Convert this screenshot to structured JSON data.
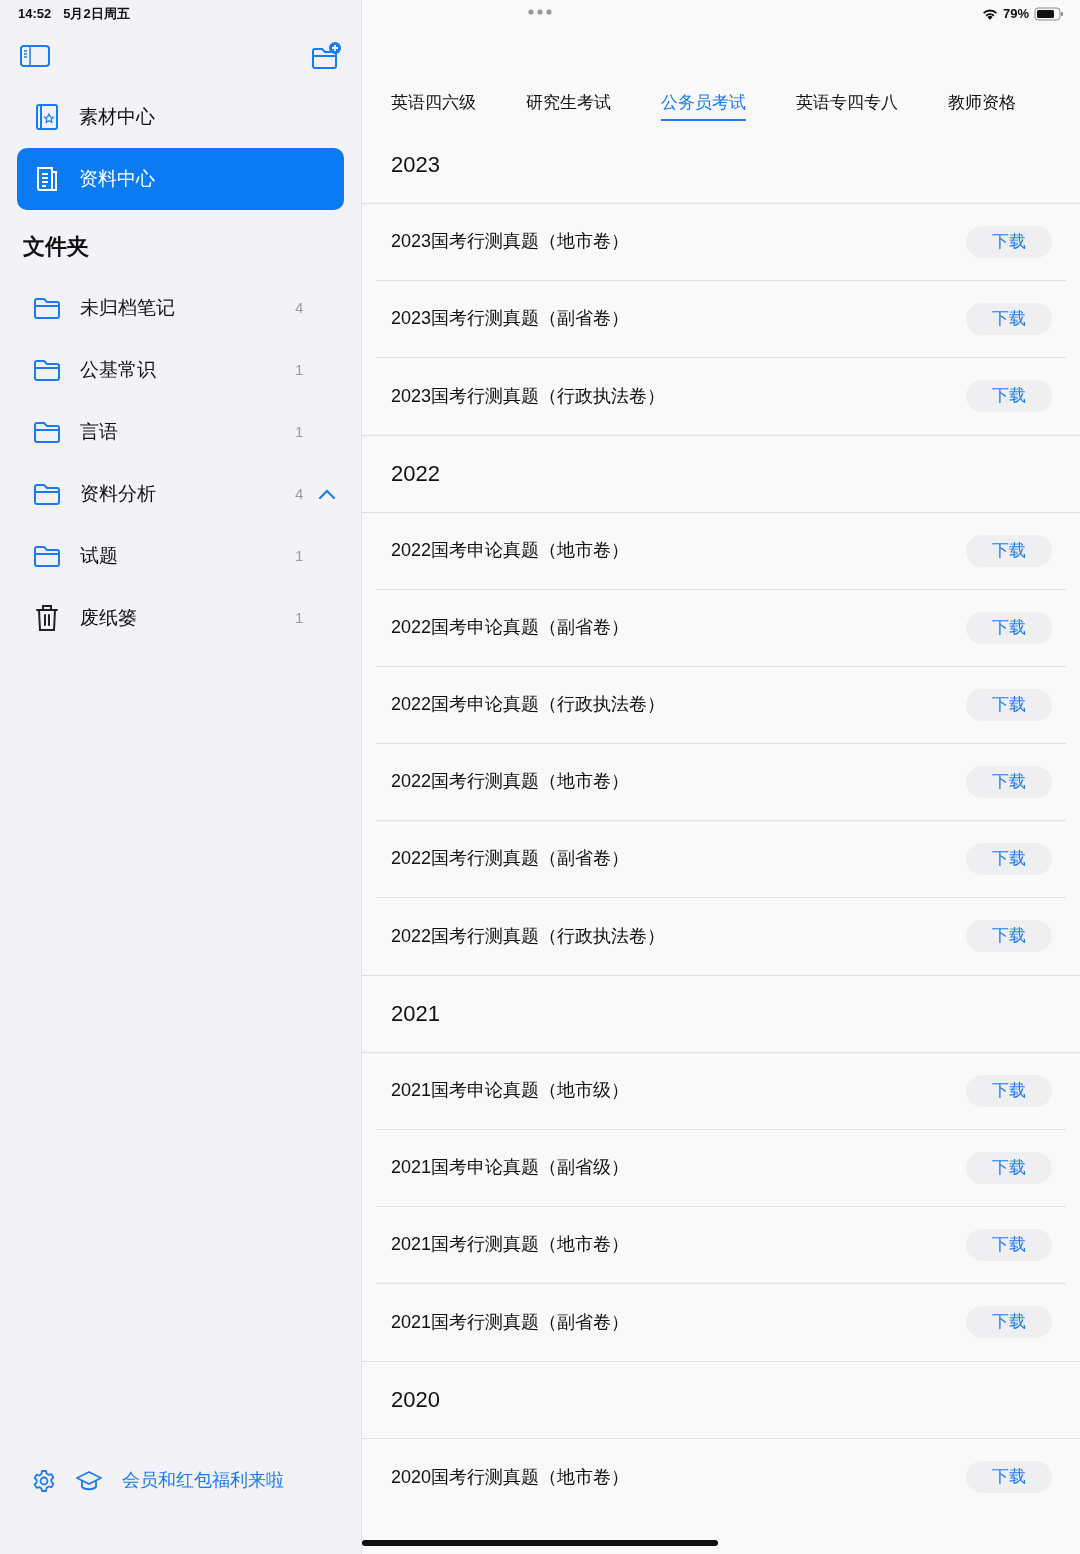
{
  "status_bar": {
    "time": "14:52",
    "date": "5月2日周五",
    "battery": "79%"
  },
  "sidebar": {
    "nav": [
      {
        "label": "素材中心",
        "kind": "book",
        "selected": false
      },
      {
        "label": "资料中心",
        "kind": "doc",
        "selected": true
      }
    ],
    "folders_title": "文件夹",
    "folders": [
      {
        "kind": "folder",
        "label": "未归档笔记",
        "count": "4"
      },
      {
        "kind": "folder",
        "label": "公基常识",
        "count": "1"
      },
      {
        "kind": "folder",
        "label": "言语",
        "count": "1"
      },
      {
        "kind": "folder",
        "label": "资料分析",
        "count": "4",
        "expanded": true
      },
      {
        "kind": "folder",
        "label": "试题",
        "count": "1"
      },
      {
        "kind": "trash",
        "label": "废纸篓",
        "count": "1"
      }
    ],
    "footer_link": "会员和红包福利来啦"
  },
  "tabs": [
    {
      "label": "英语四六级",
      "selected": false
    },
    {
      "label": "研究生考试",
      "selected": false
    },
    {
      "label": "公务员考试",
      "selected": true
    },
    {
      "label": "英语专四专八",
      "selected": false
    },
    {
      "label": "教师资格",
      "selected": false
    }
  ],
  "sections": [
    {
      "year": "2023",
      "items": [
        {
          "title": "2023国考行测真题（地市卷）",
          "action": "下载"
        },
        {
          "title": "2023国考行测真题（副省卷）",
          "action": "下载"
        },
        {
          "title": "2023国考行测真题（行政执法卷）",
          "action": "下载"
        }
      ]
    },
    {
      "year": "2022",
      "items": [
        {
          "title": "2022国考申论真题（地市卷）",
          "action": "下载"
        },
        {
          "title": "2022国考申论真题（副省卷）",
          "action": "下载"
        },
        {
          "title": "2022国考申论真题（行政执法卷）",
          "action": "下载"
        },
        {
          "title": "2022国考行测真题（地市卷）",
          "action": "下载"
        },
        {
          "title": "2022国考行测真题（副省卷）",
          "action": "下载"
        },
        {
          "title": "2022国考行测真题（行政执法卷）",
          "action": "下载"
        }
      ]
    },
    {
      "year": "2021",
      "items": [
        {
          "title": "2021国考申论真题（地市级）",
          "action": "下载"
        },
        {
          "title": "2021国考申论真题（副省级）",
          "action": "下载"
        },
        {
          "title": "2021国考行测真题（地市卷）",
          "action": "下载"
        },
        {
          "title": "2021国考行测真题（副省卷）",
          "action": "下载"
        }
      ]
    },
    {
      "year": "2020",
      "items": [
        {
          "title": "2020国考行测真题（地市卷）",
          "action": "下载"
        }
      ]
    }
  ]
}
